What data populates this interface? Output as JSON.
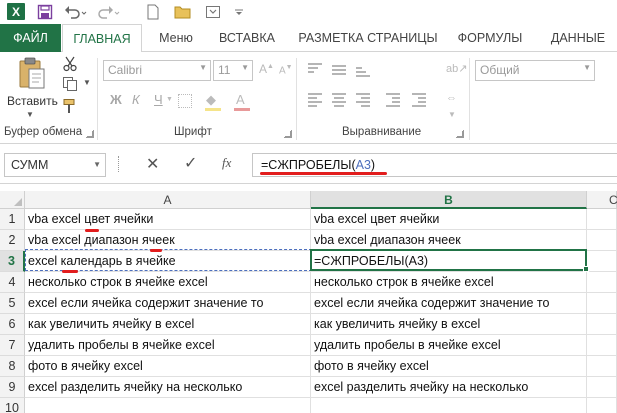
{
  "app": {
    "icon_letter": "X"
  },
  "tabs": [
    {
      "label": "ФАЙЛ"
    },
    {
      "label": "ГЛАВНАЯ"
    },
    {
      "label": "Меню"
    },
    {
      "label": "ВСТАВКА"
    },
    {
      "label": "РАЗМЕТКА СТРАНИЦЫ"
    },
    {
      "label": "ФОРМУЛЫ"
    },
    {
      "label": "ДАННЫЕ"
    }
  ],
  "ribbon": {
    "clipboard": {
      "paste_label": "Вставить",
      "group_label": "Буфер обмена"
    },
    "font": {
      "name": "Calibri",
      "size": "11",
      "group_label": "Шрифт",
      "bold": "Ж",
      "italic": "К",
      "underline": "Ч"
    },
    "alignment": {
      "group_label": "Выравнивание"
    },
    "number": {
      "format": "Общий"
    }
  },
  "formula_bar": {
    "name_box": "СУММ",
    "fx": "fx",
    "formula_prefix": "=СЖПРОБЕЛЫ(",
    "formula_ref": "A3",
    "formula_suffix": ")"
  },
  "columns": [
    "A",
    "B",
    "C"
  ],
  "rows": [
    {
      "n": "1",
      "a": "vba excel  цвет ячейки",
      "b": "vba excel цвет ячейки"
    },
    {
      "n": "2",
      "a": "vba excel диапазон  ячеек",
      "b": "vba excel диапазон ячеек"
    },
    {
      "n": "3",
      "a": "excel   календарь в ячейке",
      "b": "=СЖПРОБЕЛЫ(A3)"
    },
    {
      "n": "4",
      "a": "несколько строк в ячейке excel",
      "b": "несколько строк в ячейке excel"
    },
    {
      "n": "5",
      "a": "excel если ячейка содержит значение то",
      "b": "excel если ячейка содержит значение то"
    },
    {
      "n": "6",
      "a": "как увеличить ячейку в excel",
      "b": "как увеличить ячейку в excel"
    },
    {
      "n": "7",
      "a": "удалить пробелы в ячейке excel",
      "b": "удалить пробелы в ячейке excel"
    },
    {
      "n": "8",
      "a": "фото в ячейку excel",
      "b": "фото в ячейку excel"
    },
    {
      "n": "9",
      "a": "excel разделить ячейку на несколько",
      "b": "excel разделить ячейку на несколько"
    },
    {
      "n": "10",
      "a": "",
      "b": ""
    }
  ],
  "colors": {
    "accent": "#217346",
    "annotation": "#e21d1d",
    "reference": "#4d6fbd"
  }
}
